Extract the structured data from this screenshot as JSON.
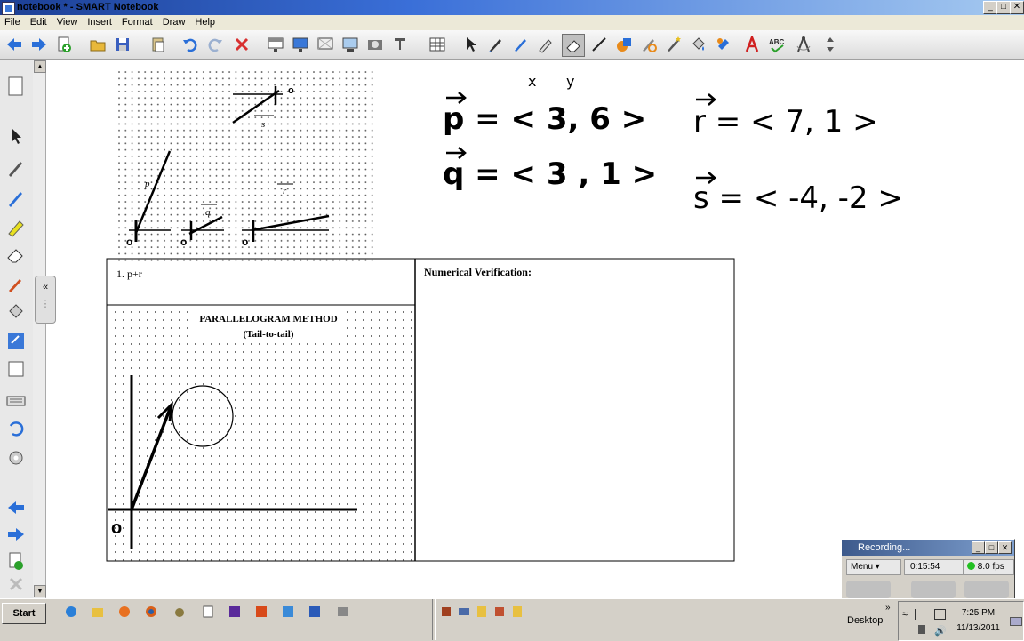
{
  "window": {
    "title": "notebook * - SMART Notebook"
  },
  "menu": [
    "File",
    "Edit",
    "View",
    "Insert",
    "Format",
    "Draw",
    "Help"
  ],
  "worksheet": {
    "problem": "1.  p+r",
    "verification_heading": "Numerical Verification:",
    "method_title": "PARALLELOGRAM METHOD",
    "method_subtitle": "(Tail-to-tail)",
    "vector_labels": {
      "s": "s",
      "p": "p",
      "q": "q",
      "r": "r",
      "origin": "o"
    }
  },
  "handwriting": {
    "xy_header": [
      "x",
      "y"
    ],
    "p_eq": "p = < 3, 6 >",
    "q_eq": "q = < 3 , 1 >",
    "r_eq": "r = < 7, 1 >",
    "s_eq": "s = < -4, -2 >"
  },
  "recorder": {
    "title": "Recording...",
    "menu_label": "Menu",
    "elapsed": "0:15:54",
    "fps": "8.0 fps",
    "status_color": "#22c022"
  },
  "taskbar": {
    "start_label": "Start",
    "desktop_label": "Desktop",
    "time": "7:25 PM",
    "date": "11/13/2011"
  }
}
